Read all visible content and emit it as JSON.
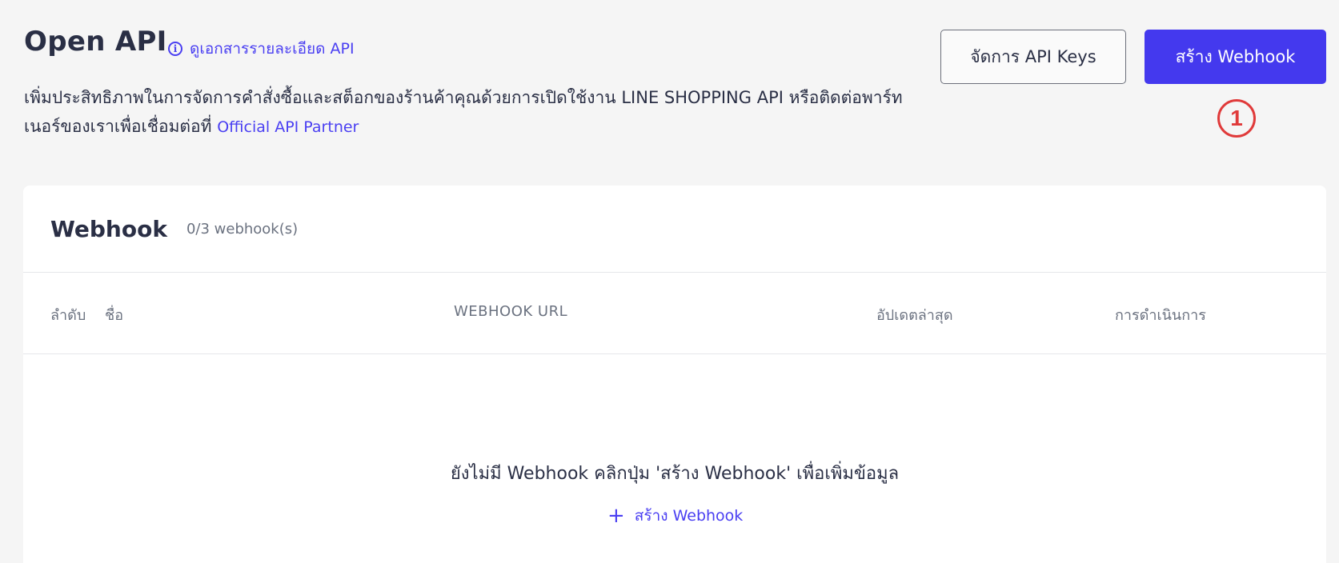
{
  "header": {
    "title": "Open API",
    "doc_link": "ดูเอกสารรายละเอียด API",
    "description": "เพิ่มประสิทธิภาพในการจัดการคำสั่งซื้อและสต็อกของร้านค้าคุณด้วยการเปิดใช้งาน LINE SHOPPING API หรือติดต่อพาร์ทเนอร์ของเราเพื่อเชื่อมต่อที่",
    "partner_link": "Official API Partner",
    "manage_keys_label": "จัดการ API Keys",
    "create_webhook_label": "สร้าง Webhook",
    "step_marker": "1"
  },
  "webhook_card": {
    "title": "Webhook",
    "count": "0/3 webhook(s)",
    "columns": [
      "ลำดับ",
      "ชื่อ",
      "WEBHOOK URL",
      "อัปเดตล่าสุด",
      "การดำเนินการ"
    ],
    "empty_message": "ยังไม่มี Webhook คลิกปุ่ม 'สร้าง Webhook' เพื่อเพิ่มข้อมูล",
    "empty_create_label": "สร้าง Webhook"
  },
  "icons": {
    "info": "info-icon",
    "plus": "plus-icon"
  },
  "colors": {
    "accent": "#4439ee",
    "link": "#4a3ff2",
    "marker": "#e03a3a",
    "background": "#f5f5f5"
  }
}
